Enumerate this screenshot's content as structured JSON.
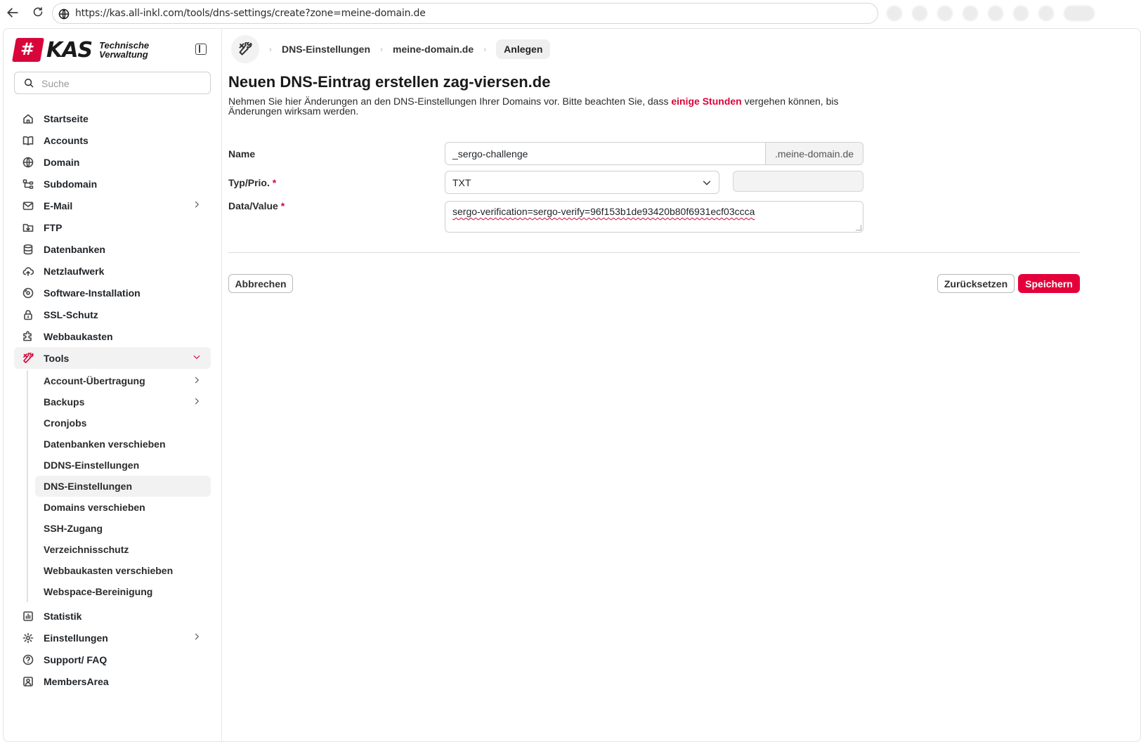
{
  "browser": {
    "url": "https://kas.all-inkl.com/tools/dns-settings/create?zone=meine-domain.de"
  },
  "brand": {
    "name": "KAS",
    "subtitle_line1": "Technische",
    "subtitle_line2": "Verwaltung",
    "accent_color": "#d8063b"
  },
  "search": {
    "placeholder": "Suche"
  },
  "menu": {
    "items": [
      {
        "label": "Startseite",
        "icon": "home-icon"
      },
      {
        "label": "Accounts",
        "icon": "book-icon"
      },
      {
        "label": "Domain",
        "icon": "globe-icon"
      },
      {
        "label": "Subdomain",
        "icon": "subdomain-icon"
      },
      {
        "label": "E-Mail",
        "icon": "mail-icon",
        "has_children": true
      },
      {
        "label": "FTP",
        "icon": "folder-download-icon"
      },
      {
        "label": "Datenbanken",
        "icon": "database-icon"
      },
      {
        "label": "Netzlaufwerk",
        "icon": "cloud-upload-icon"
      },
      {
        "label": "Software-Installation",
        "icon": "disc-icon"
      },
      {
        "label": "SSL-Schutz",
        "icon": "lock-icon"
      },
      {
        "label": "Webbaukasten",
        "icon": "puzzle-icon"
      },
      {
        "label": "Tools",
        "icon": "tools-icon",
        "expanded": true
      }
    ],
    "tools_sub": [
      {
        "label": "Account-Übertragung",
        "has_children": true
      },
      {
        "label": "Backups",
        "has_children": true
      },
      {
        "label": "Cronjobs"
      },
      {
        "label": "Datenbanken verschieben"
      },
      {
        "label": "DDNS-Einstellungen"
      },
      {
        "label": "DNS-Einstellungen",
        "active": true
      },
      {
        "label": "Domains verschieben"
      },
      {
        "label": "SSH-Zugang"
      },
      {
        "label": "Verzeichnisschutz"
      },
      {
        "label": "Webbaukasten verschieben"
      },
      {
        "label": "Webspace-Bereinigung"
      }
    ],
    "bottom": [
      {
        "label": "Statistik",
        "icon": "chart-icon"
      },
      {
        "label": "Einstellungen",
        "icon": "gear-icon",
        "has_children": true
      },
      {
        "label": "Support/ FAQ",
        "icon": "help-icon"
      },
      {
        "label": "MembersArea",
        "icon": "user-icon"
      }
    ]
  },
  "breadcrumb": {
    "items": [
      "DNS-Einstellungen",
      "meine-domain.de"
    ],
    "current": "Anlegen"
  },
  "page": {
    "title": "Neuen DNS-Eintrag erstellen zag-viersen.de",
    "desc_before": "Nehmen Sie hier Änderungen an den DNS-Einstellungen Ihrer Domains vor. Bitte beachten Sie, dass ",
    "desc_highlight": "einige Stunden",
    "desc_after": " vergehen können, bis Änderungen wirksam werden."
  },
  "form": {
    "name_label": "Name",
    "name_value": "_sergo-challenge",
    "name_suffix": ".meine-domain.de",
    "type_label": "Typ/Prio.",
    "type_value": "TXT",
    "prio_value": "",
    "data_label": "Data/Value",
    "data_value": "sergo-verification=sergo-verify=96f153b1de93420b80f6931ecf03ccca",
    "required_mark": "*"
  },
  "buttons": {
    "cancel": "Abbrechen",
    "reset": "Zurücksetzen",
    "save": "Speichern"
  }
}
